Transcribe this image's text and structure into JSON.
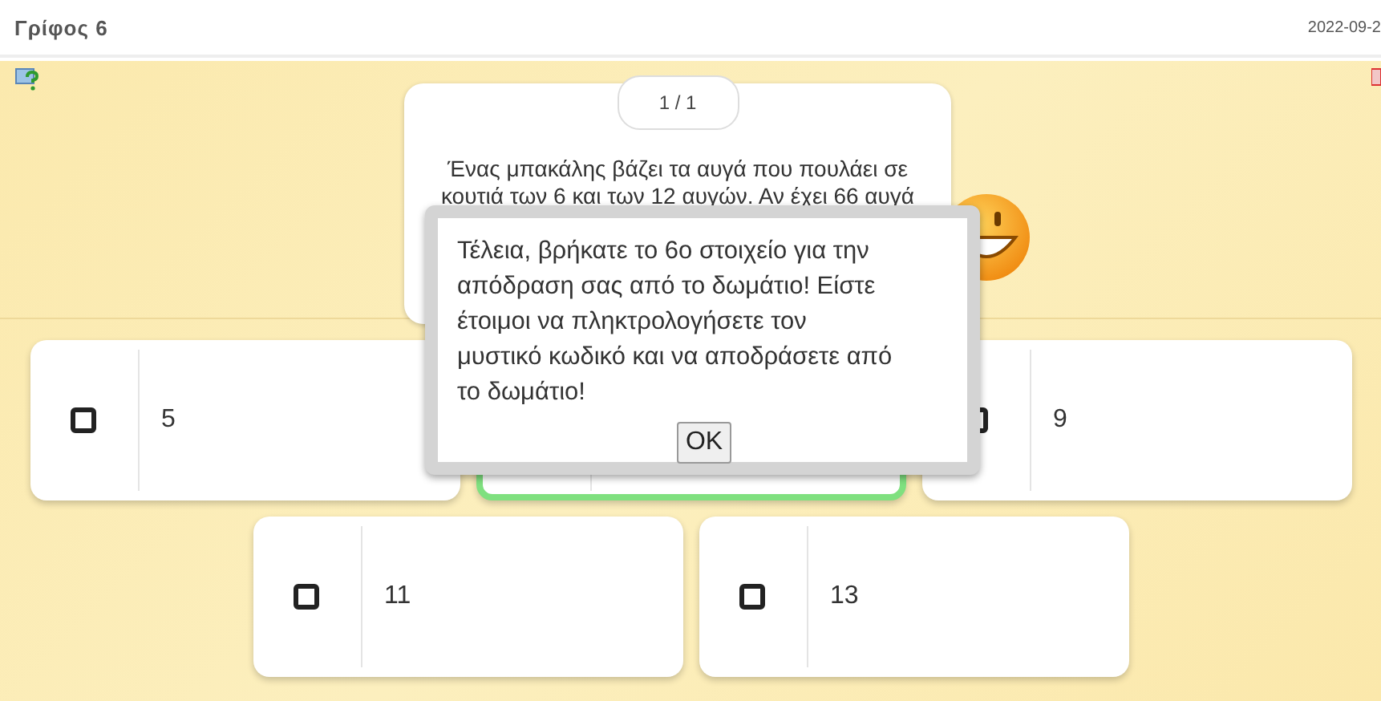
{
  "header": {
    "title": "Γρίφος 6",
    "date": "2022-09-2"
  },
  "question": {
    "counter": "1 / 1",
    "lines": [
      "Ένας μπακάλης βάζει τα αυγά που πουλάει σε",
      "κουτιά των 6 και των 12 αυγών. Αν έχει 66 αυγά"
    ]
  },
  "answers": [
    {
      "label": "5",
      "selected": false
    },
    {
      "selected": true
    },
    {
      "label": "9",
      "selected": false
    },
    {
      "label": "11",
      "selected": false
    },
    {
      "label": "13",
      "selected": false
    }
  ],
  "dialog": {
    "message": "Τέλεια, βρήκατε το 6ο στοιχείο για την απόδραση σας από το δωμάτιο! Είστε έτοιμοι να πληκτρολογήσετε τον μυστικό κωδικό και να αποδράσετε από το δωμάτιο!",
    "button": "OK"
  }
}
